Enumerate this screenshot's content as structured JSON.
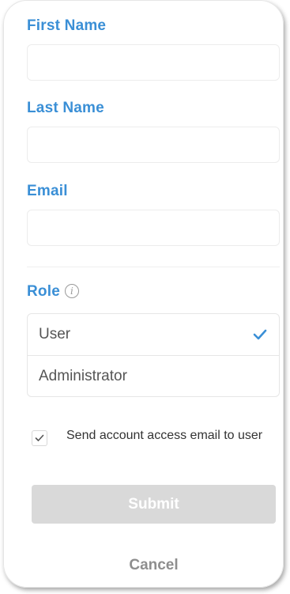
{
  "form": {
    "first_name": {
      "label": "First Name",
      "value": "",
      "placeholder": ""
    },
    "last_name": {
      "label": "Last Name",
      "value": "",
      "placeholder": ""
    },
    "email": {
      "label": "Email",
      "value": "",
      "placeholder": ""
    },
    "role": {
      "label": "Role",
      "info_icon": "info-icon",
      "info_glyph": "i",
      "options": [
        {
          "label": "User",
          "selected": true
        },
        {
          "label": "Administrator",
          "selected": false
        }
      ],
      "selected_value": "User"
    },
    "send_email": {
      "label": "Send account access email to user",
      "checked": true
    },
    "submit_label": "Submit",
    "cancel_label": "Cancel"
  },
  "colors": {
    "label_blue": "#3a8fd6",
    "check_blue": "#3a8fd6",
    "submit_disabled_bg": "#d9d9d9",
    "cancel_text": "#8e8e8e"
  }
}
